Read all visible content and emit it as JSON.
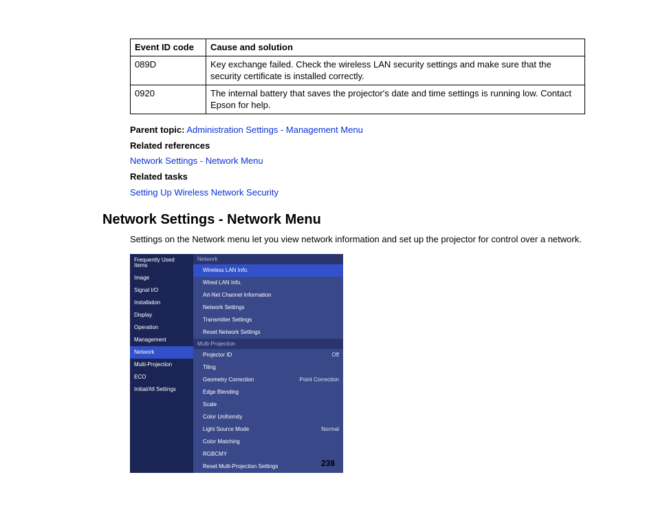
{
  "table": {
    "header_code": "Event ID code",
    "header_cause": "Cause and solution",
    "rows": [
      {
        "code": "089D",
        "cause": "Key exchange failed. Check the wireless LAN security settings and make sure that the security certificate is installed correctly."
      },
      {
        "code": "0920",
        "cause": "The internal battery that saves the projector's date and time settings is running low. Contact Epson for help."
      }
    ]
  },
  "topics": {
    "parent_label": "Parent topic:",
    "parent_link": "Administration Settings - Management Menu",
    "refs_label": "Related references",
    "refs_link": "Network Settings - Network Menu",
    "tasks_label": "Related tasks",
    "tasks_link": "Setting Up Wireless Network Security"
  },
  "section": {
    "heading": "Network Settings - Network Menu",
    "body": "Settings on the Network menu let you view network information and set up the projector for control over a network."
  },
  "menu": {
    "left": [
      "Frequently Used Items",
      "Image",
      "Signal I/O",
      "Installation",
      "Display",
      "Operation",
      "Management",
      "Network",
      "Multi-Projection",
      "ECO",
      "Initial/All Settings"
    ],
    "left_selected": "Network",
    "groups": [
      {
        "header": "Network",
        "items": [
          {
            "label": "Wireless LAN Info.",
            "value": "",
            "sel": true
          },
          {
            "label": "Wired LAN Info.",
            "value": ""
          },
          {
            "label": "Art-Net Channel Information",
            "value": ""
          },
          {
            "label": "Network Settings",
            "value": ""
          },
          {
            "label": "Transmitter Settings",
            "value": ""
          },
          {
            "label": "Reset Network Settings",
            "value": ""
          }
        ]
      },
      {
        "header": "Multi-Projection",
        "items": [
          {
            "label": "Projector ID",
            "value": "Off"
          },
          {
            "label": "Tiling",
            "value": ""
          },
          {
            "label": "Geometry Correction",
            "value": "Point Correction"
          },
          {
            "label": "Edge Blending",
            "value": ""
          },
          {
            "label": "Scale",
            "value": ""
          },
          {
            "label": "Color Uniformity",
            "value": ""
          },
          {
            "label": "Light Source Mode",
            "value": "Normal"
          },
          {
            "label": "Color Matching",
            "value": ""
          },
          {
            "label": "RGBCMY",
            "value": ""
          },
          {
            "label": "Reset Multi-Projection Settings",
            "value": ""
          }
        ]
      }
    ]
  },
  "page_number": "238"
}
